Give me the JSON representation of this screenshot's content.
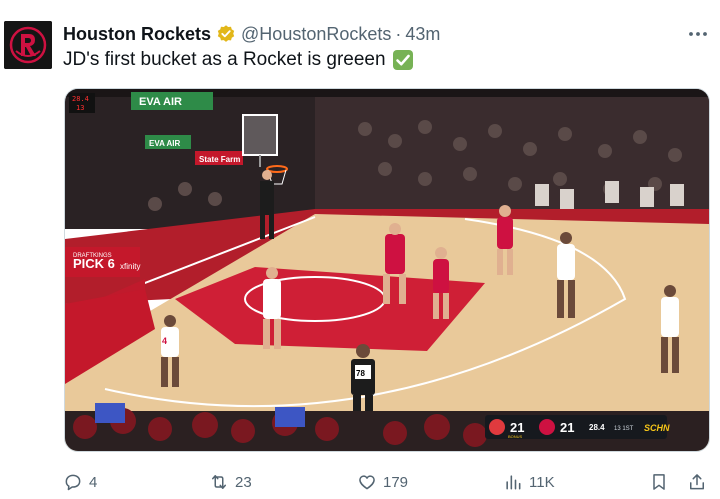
{
  "tweet": {
    "author_name": "Houston Rockets",
    "handle": "@HoustonRockets",
    "separator": "·",
    "time": "43m",
    "text": "JD's first bucket as a Rocket is greeen",
    "text_emoji": "check-mark-button-icon"
  },
  "media": {
    "arena_ads": {
      "banner_1": "EVA AIR",
      "banner_2": "EVA AIR",
      "banner_3": "State Farm",
      "pick6": "PICK 6",
      "pick6_small": "DRAFTKINGS",
      "xfinity": "xfinity"
    },
    "shot_clock": {
      "top": "28.4",
      "bottom": "13"
    },
    "jersey_numbers": [
      "4",
      "78"
    ],
    "scorebug": {
      "away_score": "21",
      "home_score": "21",
      "game_clock": "28.4",
      "quarter": "13 1ST",
      "bonus_label": "BONUS",
      "network": "SCHN"
    }
  },
  "actions": {
    "replies": "4",
    "retweets": "23",
    "likes": "179",
    "views": "11K"
  },
  "colors": {
    "accent_red": "#ce1141",
    "court_wood": "#e9c99a",
    "verified_gold": "#e2b719",
    "check_green": "#77b255"
  }
}
